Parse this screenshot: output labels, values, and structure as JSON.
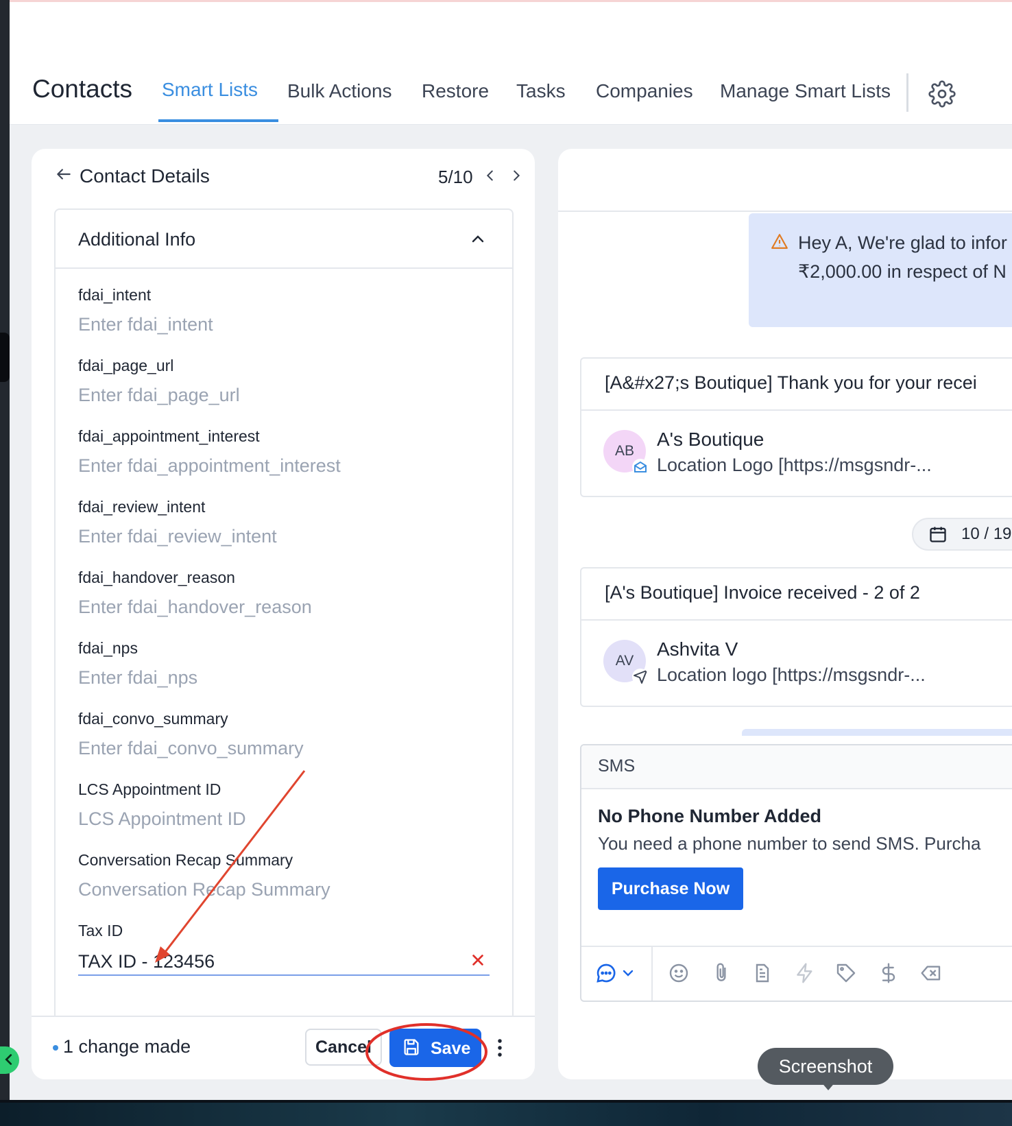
{
  "header": {
    "title": "Contacts",
    "tabs": [
      {
        "label": "Smart Lists",
        "active": true
      },
      {
        "label": "Bulk Actions"
      },
      {
        "label": "Restore"
      },
      {
        "label": "Tasks"
      },
      {
        "label": "Companies"
      },
      {
        "label": "Manage Smart Lists"
      }
    ],
    "settings_icon": "gear-icon"
  },
  "contact_details": {
    "title": "Contact Details",
    "pager": "5/10",
    "section_title": "Additional Info",
    "fields": [
      {
        "label": "fdai_intent",
        "placeholder": "Enter fdai_intent"
      },
      {
        "label": "fdai_page_url",
        "placeholder": "Enter fdai_page_url"
      },
      {
        "label": "fdai_appointment_interest",
        "placeholder": "Enter fdai_appointment_interest"
      },
      {
        "label": "fdai_review_intent",
        "placeholder": "Enter fdai_review_intent"
      },
      {
        "label": "fdai_handover_reason",
        "placeholder": "Enter fdai_handover_reason"
      },
      {
        "label": "fdai_nps",
        "placeholder": "Enter fdai_nps"
      },
      {
        "label": "fdai_convo_summary",
        "placeholder": "Enter fdai_convo_summary"
      },
      {
        "label": "LCS Appointment ID",
        "placeholder": "LCS Appointment ID"
      },
      {
        "label": "Conversation Recap Summary",
        "placeholder": "Conversation Recap Summary"
      }
    ],
    "tax_field": {
      "label": "Tax ID",
      "value": "TAX ID - 123456"
    },
    "footer": {
      "change_text": "1 change made",
      "cancel_label": "Cancel",
      "save_label": "Save"
    }
  },
  "conversation": {
    "alert_line1": "Hey A, We're glad to infor",
    "alert_line2": "₹2,000.00 in respect of N",
    "emails": [
      {
        "subject": "[A&#x27;s Boutique] Thank you for your recei",
        "avatar": "AB",
        "sender": "A's Boutique",
        "preview": "Location Logo [https://msgsndr-...",
        "avatar_color": "#f3d6f7"
      },
      {
        "subject": "[A's Boutique] Invoice received - 2 of 2",
        "avatar": "AV",
        "sender": "Ashvita V",
        "preview": "Location logo [https://msgsndr-...",
        "avatar_color": "#e2e0f8"
      }
    ],
    "date_pill": "10 / 19",
    "sms": {
      "tab_label": "SMS",
      "title": "No Phone Number Added",
      "text": "You need a phone number to send SMS. Purcha",
      "button": "Purchase Now"
    }
  },
  "tooltip": "Screenshot",
  "colors": {
    "accent": "#3a8ee0",
    "primary_button": "#1a66e8",
    "annotation": "#e0452f"
  }
}
